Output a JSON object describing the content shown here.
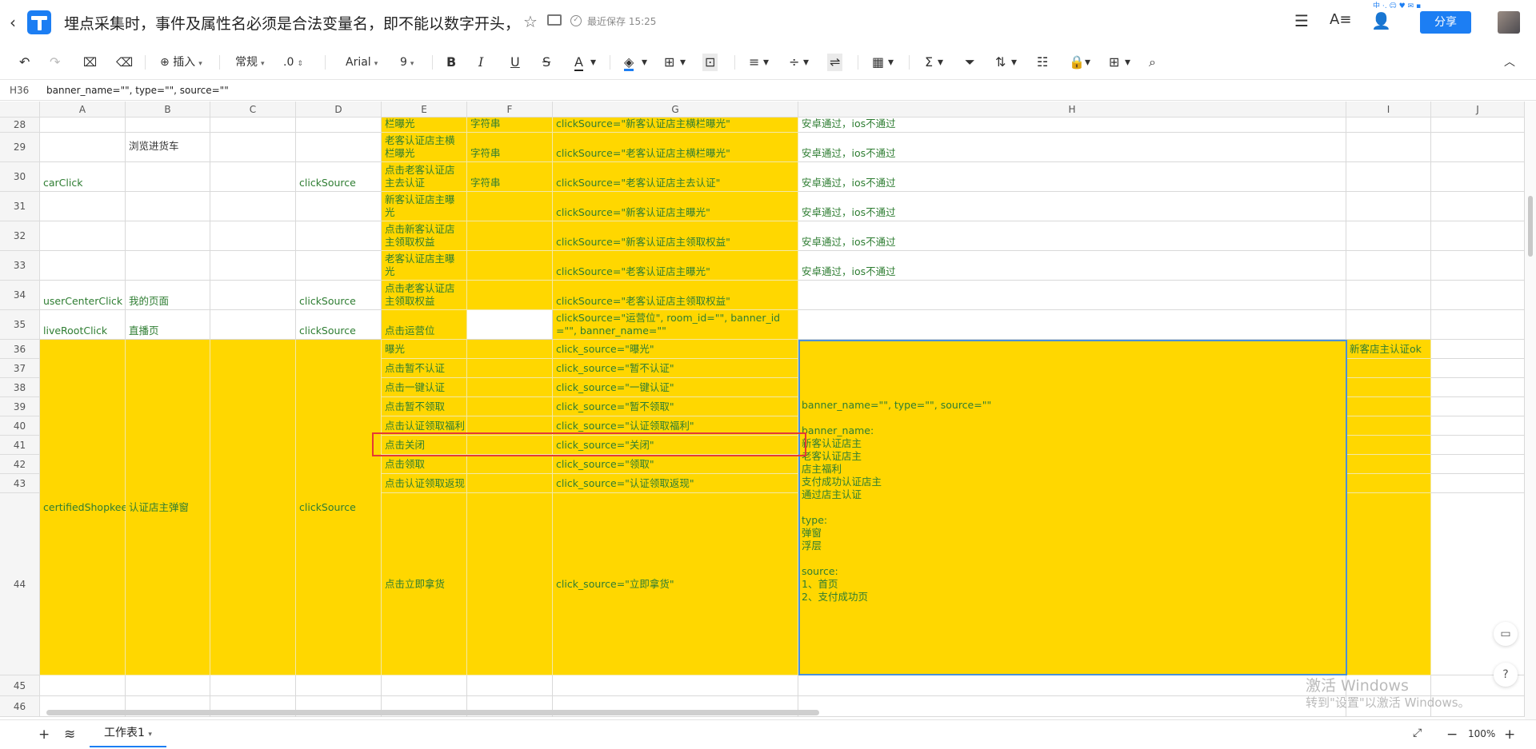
{
  "header": {
    "back_icon": "‹",
    "title": "埋点采集时，事件及属性名必须是合法变量名，即不能以数字开头，…",
    "save_status": "最近保存 15:25",
    "share_label": "分享",
    "tray_text": "中 ·, ☺ ♥ ✉ ▪"
  },
  "toolbar": {
    "insert_label": "插入",
    "format_label": "常规",
    "decimal_label": ".0",
    "font_label": "Arial",
    "size_label": "9"
  },
  "formula_bar": {
    "cell_ref": "H36",
    "content": "banner_name=\"\", type=\"\", source=\"\""
  },
  "columns": [
    "A",
    "B",
    "C",
    "D",
    "E",
    "F",
    "G",
    "H",
    "I",
    "J"
  ],
  "rows": [
    {
      "num": "28",
      "A": "",
      "B": "",
      "C": "",
      "D": "",
      "E": "栏曝光",
      "F": "字符串",
      "G": "clickSource=\"新客认证店主横栏曝光\"",
      "H": "安卓通过，ios不通过",
      "I": ""
    },
    {
      "num": "29",
      "A": "",
      "B": "浏览进货车",
      "C": "",
      "D": "",
      "E": "老客认证店主横栏曝光",
      "F": "字符串",
      "G": "clickSource=\"老客认证店主横栏曝光\"",
      "H": "安卓通过，ios不通过",
      "I": ""
    },
    {
      "num": "30",
      "A": "carClick",
      "B": "",
      "C": "",
      "D": "clickSource",
      "E": "点击老客认证店主去认证",
      "F": "字符串",
      "G": "clickSource=\"老客认证店主去认证\"",
      "H": "安卓通过，ios不通过",
      "I": ""
    },
    {
      "num": "31",
      "A": "",
      "B": "",
      "C": "",
      "D": "",
      "E": "新客认证店主曝光",
      "F": "",
      "G": "clickSource=\"新客认证店主曝光\"",
      "H": "安卓通过，ios不通过",
      "I": ""
    },
    {
      "num": "32",
      "A": "",
      "B": "",
      "C": "",
      "D": "",
      "E": "点击新客认证店主领取权益",
      "F": "",
      "G": "clickSource=\"新客认证店主领取权益\"",
      "H": "安卓通过，ios不通过",
      "I": ""
    },
    {
      "num": "33",
      "A": "",
      "B": "",
      "C": "",
      "D": "",
      "E": "老客认证店主曝光",
      "F": "",
      "G": "clickSource=\"老客认证店主曝光\"",
      "H": "安卓通过，ios不通过",
      "I": ""
    },
    {
      "num": "34",
      "A": "userCenterClick",
      "B": "我的页面",
      "C": "",
      "D": "clickSource",
      "E": "点击老客认证店主领取权益",
      "F": "",
      "G": "clickSource=\"老客认证店主领取权益\"",
      "H": "",
      "I": ""
    },
    {
      "num": "35",
      "A": "liveRootClick",
      "B": "直播页",
      "C": "",
      "D": "clickSource",
      "E": "点击运营位",
      "F": "",
      "G": "clickSource=\"运营位\", room_id=\"\", banner_id=\"\", banner_name=\"\"",
      "H": "",
      "I": ""
    },
    {
      "num": "36",
      "E": "曝光",
      "G": "click_source=\"曝光\"",
      "I": "新客店主认证ok"
    },
    {
      "num": "37",
      "E": "点击暂不认证",
      "G": "click_source=\"暂不认证\"",
      "I": ""
    },
    {
      "num": "38",
      "E": "点击一键认证",
      "G": "click_source=\"一键认证\"",
      "I": ""
    },
    {
      "num": "39",
      "E": "点击暂不领取",
      "G": "click_source=\"暂不领取\"",
      "I": ""
    },
    {
      "num": "40",
      "E": "点击认证领取福利",
      "G": "click_source=\"认证领取福利\"",
      "I": ""
    },
    {
      "num": "41",
      "E": "点击关闭",
      "G": "click_source=\"关闭\"",
      "I": ""
    },
    {
      "num": "42",
      "E": "点击领取",
      "G": "click_source=\"领取\"",
      "I": ""
    },
    {
      "num": "43",
      "E": "点击认证领取返现",
      "G": "click_source=\"认证领取返现\"",
      "I": ""
    },
    {
      "num": "44",
      "E": "点击立即拿货",
      "G": "click_source=\"立即拿货\"",
      "I": ""
    },
    {
      "num": "45"
    },
    {
      "num": "46"
    }
  ],
  "merged": {
    "A36": "certifiedShopkeeper",
    "B36": "认证店主弹窗",
    "D36": "clickSource",
    "H36": "banner_name=\"\", type=\"\", source=\"\"\n\nbanner_name:\n新客认证店主\n老客认证店主\n店主福利\n支付成功认证店主\n通过店主认证\n\ntype:\n弹窗\n浮层\n\nsource:\n1、首页\n2、支付成功页"
  },
  "footer": {
    "sheet_name": "工作表1",
    "zoom": "100%"
  },
  "watermark": {
    "line1": "激活 Windows",
    "line2": "转到\"设置\"以激活 Windows。"
  },
  "colors": {
    "accent": "#1c7ef3",
    "highlight": "#ffd700",
    "text_green": "#2e7d32",
    "red_outline": "#e53935"
  }
}
